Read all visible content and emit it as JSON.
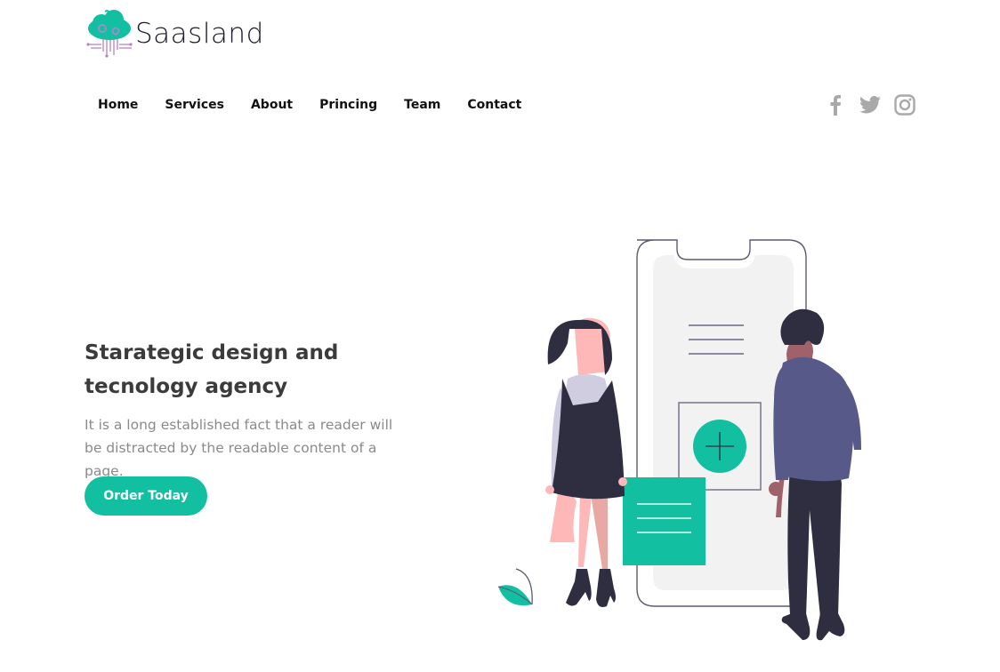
{
  "brand": {
    "name": "Saasland"
  },
  "nav": {
    "items": [
      {
        "label": "Home"
      },
      {
        "label": "Services"
      },
      {
        "label": "About"
      },
      {
        "label": "Princing"
      },
      {
        "label": "Team"
      },
      {
        "label": "Contact"
      }
    ]
  },
  "social": {
    "icons": [
      "facebook-icon",
      "twitter-icon",
      "instagram-icon"
    ],
    "color": "#a9a9a9"
  },
  "hero": {
    "title": "Starategic design and tecnology agency",
    "description": "It is a long established fact that a reader will be distracted by the readable content of a page.",
    "cta_label": "Order Today"
  },
  "colors": {
    "accent": "#12bfa0",
    "heading": "#3b3b3b",
    "body_text": "#8a8a8a",
    "hoodie": "#575a89",
    "dark": "#2f2e41"
  }
}
